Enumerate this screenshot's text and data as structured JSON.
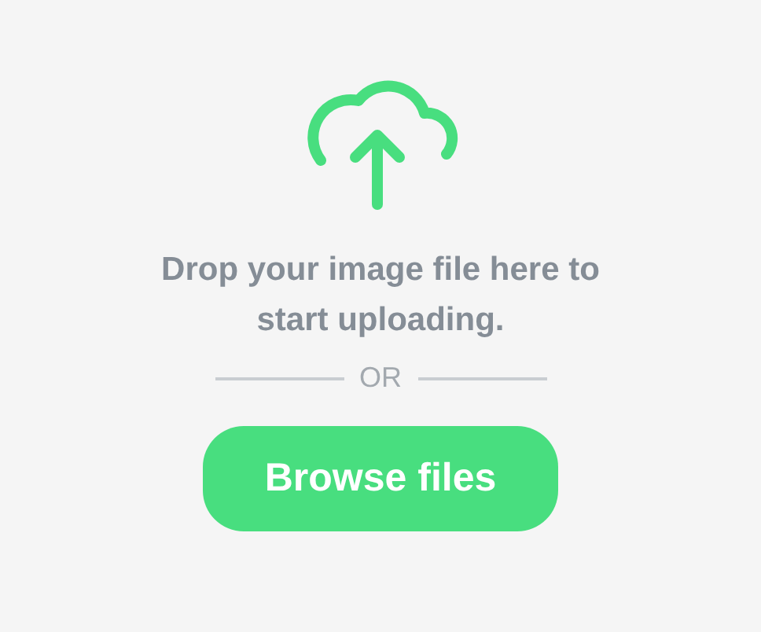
{
  "upload": {
    "message": "Drop your image file here to start uploading.",
    "divider": "OR",
    "button": "Browse files"
  }
}
